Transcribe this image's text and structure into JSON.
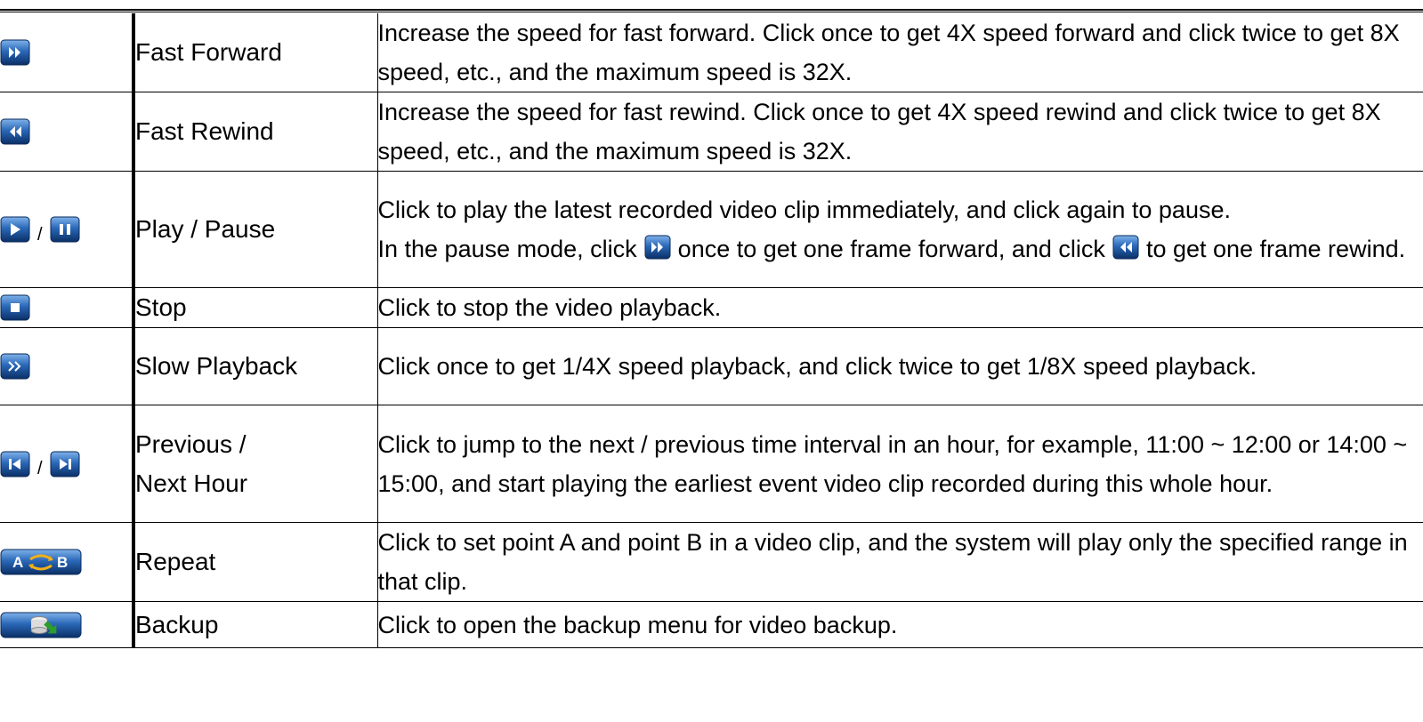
{
  "rows": [
    {
      "icons": [
        "fast-forward-icon"
      ],
      "function": "Fast Forward",
      "description": "Increase the speed for fast forward. Click once to get 4X speed forward and click twice to get 8X speed, etc., and the maximum speed is 32X."
    },
    {
      "icons": [
        "fast-rewind-icon"
      ],
      "function": "Fast Rewind",
      "description": "Increase the speed for fast rewind. Click once to get 4X speed rewind and click twice to get 8X speed, etc., and the maximum speed is 32X."
    },
    {
      "icons": [
        "play-icon",
        "pause-icon"
      ],
      "separator": "/",
      "function": "Play / Pause",
      "description_line1": "Click to play the latest recorded video clip immediately, and click again to pause.",
      "description_part_a": "In the pause mode, click",
      "description_part_b": "once to get one frame forward, and click",
      "description_part_c": "to get one frame rewind.",
      "inline_icons": [
        "fast-forward-icon",
        "fast-rewind-icon"
      ]
    },
    {
      "icons": [
        "stop-icon"
      ],
      "function": "Stop",
      "description": "Click to stop the video playback."
    },
    {
      "icons": [
        "slow-playback-icon"
      ],
      "function": "Slow Playback",
      "description": "Click once to get 1/4X speed playback, and click twice to get 1/8X speed playback."
    },
    {
      "icons": [
        "previous-hour-icon",
        "next-hour-icon"
      ],
      "separator": "/",
      "function_line1": "Previous /",
      "function_line2": "Next Hour",
      "description": "Click to jump to the next / previous time interval in an hour, for example, 11:00 ~ 12:00 or 14:00 ~ 15:00, and start playing the earliest event video clip recorded during this whole hour."
    },
    {
      "icons": [
        "repeat-ab-icon"
      ],
      "icon_text": [
        "A",
        "B"
      ],
      "function": "Repeat",
      "description": "Click to set point A and point B in a video clip, and the system will play only the specified range in that clip."
    },
    {
      "icons": [
        "backup-icon"
      ],
      "function": "Backup",
      "description": "Click to open the backup menu for video backup."
    }
  ],
  "colors": {
    "icon_gradient_top": "#5f9be0",
    "icon_gradient_bottom": "#0b3a78",
    "icon_glyph": "#ffffff",
    "repeat_arrows": "#f2b018",
    "backup_arrow": "#2f9a2f"
  }
}
